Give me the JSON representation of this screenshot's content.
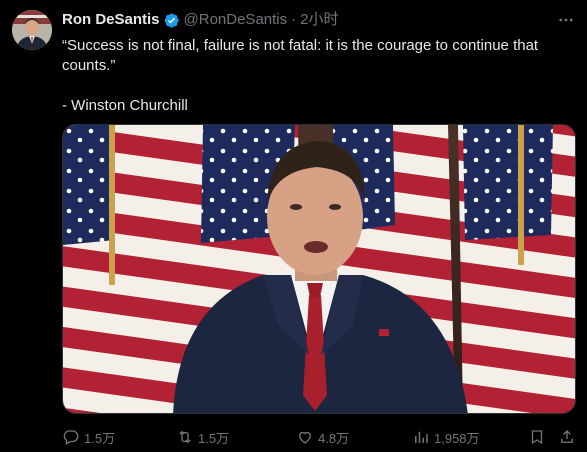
{
  "tweet": {
    "author_name": "Ron DeSantis",
    "author_handle": "@RonDeSantis",
    "separator": "·",
    "time": "2小时",
    "text_line1": "“Success is not final, failure is not fatal: it is the courage to continue that counts.”",
    "text_line2": "- Winston Churchill"
  },
  "actions": {
    "replies": "1.5万",
    "reposts": "1.5万",
    "likes": "4.8万",
    "views": "1,958万"
  },
  "colors": {
    "background": "#000000",
    "text_primary": "#e7e9ea",
    "text_secondary": "#71767b",
    "verified_blue": "#1d9bf0",
    "flag_red": "#b22234",
    "flag_blue": "#1f2a5c"
  },
  "icons": {
    "verified": "verified-badge-icon",
    "more": "more-options-icon",
    "reply": "reply-icon",
    "repost": "repost-icon",
    "like": "heart-icon",
    "views": "views-chart-icon",
    "bookmark": "bookmark-icon",
    "share": "share-icon"
  }
}
